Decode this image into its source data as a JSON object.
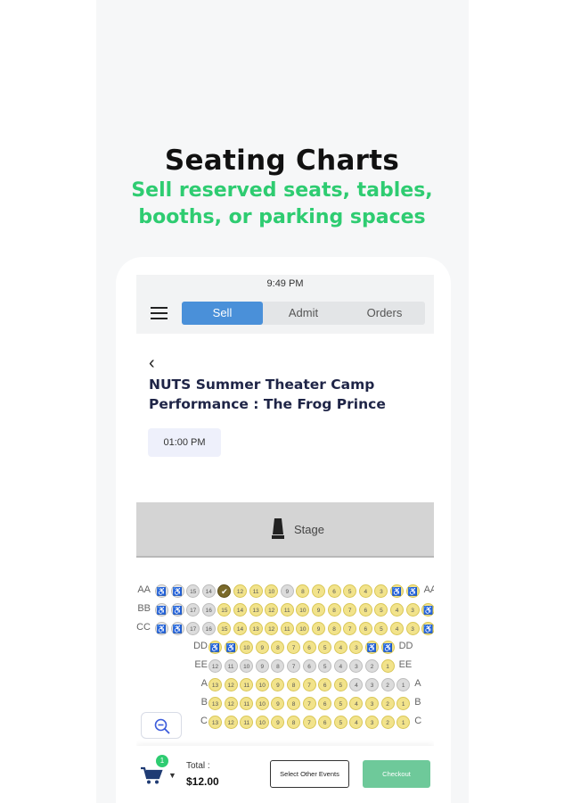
{
  "hero": {
    "title": "Seating Charts",
    "subtitle_line1": "Sell reserved seats, tables,",
    "subtitle_line2": "booths, or parking spaces"
  },
  "status_bar": {
    "time": "9:49 PM"
  },
  "nav": {
    "tabs": [
      {
        "label": "Sell",
        "active": true
      },
      {
        "label": "Admit",
        "active": false
      },
      {
        "label": "Orders",
        "active": false
      }
    ]
  },
  "event": {
    "back_glyph": "‹",
    "title": "NUTS Summer Theater Camp Performance : The Frog Prince",
    "time_slot": "01:00 PM"
  },
  "stage": {
    "label": "Stage",
    "icon": "stage-icon"
  },
  "seat_rows": [
    {
      "label": "AA",
      "seats": [
        "a:♿",
        "a:♿",
        "g:15",
        "g:14",
        "k:✔",
        "y:12",
        "y:11",
        "y:10",
        "g:9",
        "y:8",
        "y:7",
        "y:6",
        "y:5",
        "y:4",
        "y:3",
        "c:♿",
        "c:♿"
      ]
    },
    {
      "label": "BB",
      "seats": [
        "a:♿",
        "a:♿",
        "g:17",
        "g:16",
        "y:15",
        "y:14",
        "y:13",
        "y:12",
        "y:11",
        "y:10",
        "y:9",
        "y:8",
        "y:7",
        "y:6",
        "y:5",
        "y:4",
        "y:3",
        "c:♿"
      ]
    },
    {
      "label": "CC",
      "seats": [
        "a:♿",
        "a:♿",
        "g:17",
        "g:16",
        "y:15",
        "y:14",
        "y:13",
        "y:12",
        "y:11",
        "y:10",
        "y:9",
        "y:8",
        "y:7",
        "y:6",
        "y:5",
        "y:4",
        "y:3",
        "c:♿"
      ]
    },
    {
      "label": "DD",
      "seats": [
        "c:♿",
        "c:♿",
        "y:10",
        "y:9",
        "y:8",
        "y:7",
        "y:6",
        "y:5",
        "y:4",
        "y:3",
        "c:♿",
        "c:♿"
      ]
    },
    {
      "label": "EE",
      "seats": [
        "g:12",
        "g:11",
        "g:10",
        "g:9",
        "g:8",
        "g:7",
        "g:6",
        "g:5",
        "g:4",
        "g:3",
        "g:2",
        "y:1"
      ]
    },
    {
      "label": "A",
      "seats": [
        "y:13",
        "y:12",
        "y:11",
        "y:10",
        "y:9",
        "y:8",
        "y:7",
        "y:6",
        "y:5",
        "g:4",
        "g:3",
        "g:2",
        "g:1"
      ]
    },
    {
      "label": "B",
      "seats": [
        "y:13",
        "y:12",
        "y:11",
        "y:10",
        "y:9",
        "y:8",
        "y:7",
        "y:6",
        "y:5",
        "y:4",
        "y:3",
        "y:2",
        "y:1"
      ]
    },
    {
      "label": "C",
      "seats": [
        "y:13",
        "y:12",
        "y:11",
        "y:10",
        "y:9",
        "y:8",
        "y:7",
        "y:6",
        "y:5",
        "y:4",
        "y:3",
        "y:2",
        "y:1"
      ]
    }
  ],
  "footer": {
    "cart_count": "1",
    "total_label": "Total :",
    "total_value": "$12.00",
    "select_other_label": "Select Other Events",
    "checkout_label": "Checkout"
  },
  "colors": {
    "accent_green": "#2ecc71",
    "tab_active": "#4a90d9",
    "seat_available": "#f2e38b",
    "seat_sold": "#dcdcdc",
    "checkout_button": "#6ec99a",
    "title_navy": "#1f2547"
  }
}
